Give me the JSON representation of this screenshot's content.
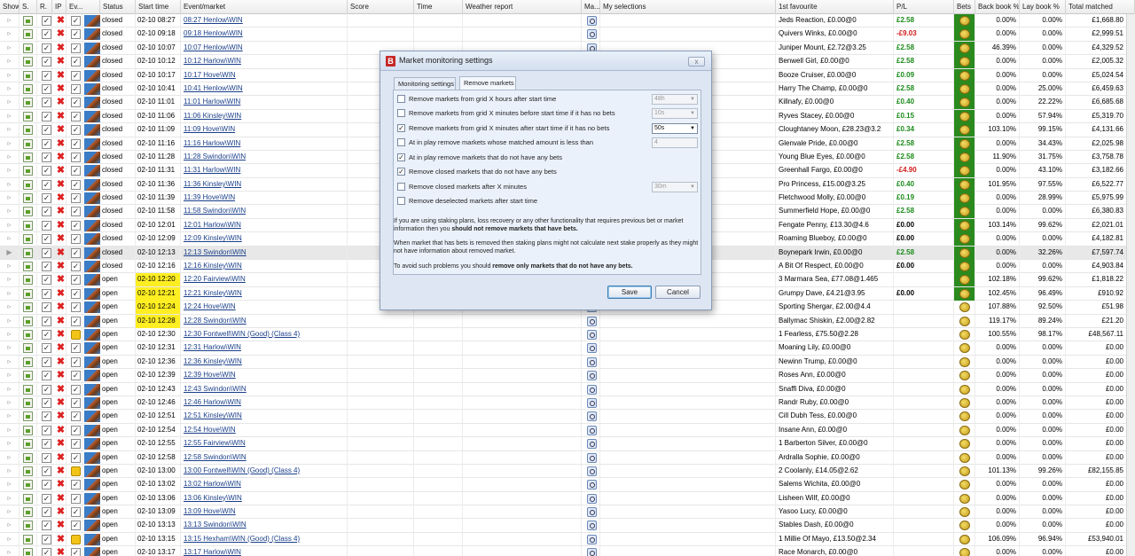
{
  "columns": {
    "show": "Show",
    "s": "S.",
    "r": "R.",
    "ip": "IP",
    "ev": "Ev...",
    "status": "Status",
    "start": "Start time",
    "event": "Event/market",
    "score": "Score",
    "time": "Time",
    "weather": "Weather report",
    "ma": "Ma...",
    "mysel": "My selections",
    "fav": "1st favourite",
    "pl": "P/L",
    "bets": "Bets",
    "back": "Back book %",
    "lay": "Lay book %",
    "total": "Total matched"
  },
  "rows": [
    {
      "status": "closed",
      "start": "02-10 08:27",
      "event": "08:27 Henlow\\WIN",
      "fav": "Jeds Reaction, £0.00@0",
      "pl": "£2.58",
      "back": "0.00%",
      "lay": "0.00%",
      "total": "£1,668.80"
    },
    {
      "status": "closed",
      "start": "02-10 09:18",
      "event": "09:18 Henlow\\WIN",
      "fav": "Quivers Winks, £0.00@0",
      "pl": "-£9.03",
      "back": "0.00%",
      "lay": "0.00%",
      "total": "£2,999.51"
    },
    {
      "status": "closed",
      "start": "02-10 10:07",
      "event": "10:07 Henlow\\WIN",
      "fav": "Juniper Mount, £2.72@3.25",
      "pl": "£2.58",
      "back": "46.39%",
      "lay": "0.00%",
      "total": "£4,329.52"
    },
    {
      "status": "closed",
      "start": "02-10 10:12",
      "event": "10:12 Harlow\\WIN",
      "fav": "Benwell Girl, £0.00@0",
      "pl": "£2.58",
      "back": "0.00%",
      "lay": "0.00%",
      "total": "£2,005.32"
    },
    {
      "status": "closed",
      "start": "02-10 10:17",
      "event": "10:17 Hove\\WIN",
      "fav": "Booze Cruiser, £0.00@0",
      "pl": "£0.09",
      "back": "0.00%",
      "lay": "0.00%",
      "total": "£5,024.54"
    },
    {
      "status": "closed",
      "start": "02-10 10:41",
      "event": "10:41 Henlow\\WIN",
      "fav": "Harry The Champ, £0.00@0",
      "pl": "£2.58",
      "back": "0.00%",
      "lay": "25.00%",
      "total": "£6,459.63"
    },
    {
      "status": "closed",
      "start": "02-10 11:01",
      "event": "11:01 Harlow\\WIN",
      "fav": "Killnafy, £0.00@0",
      "pl": "£0.40",
      "back": "0.00%",
      "lay": "22.22%",
      "total": "£6,685.68"
    },
    {
      "status": "closed",
      "start": "02-10 11:06",
      "event": "11:06 Kinsley\\WIN",
      "fav": "Ryves Stacey, £0.00@0",
      "pl": "£0.15",
      "back": "0.00%",
      "lay": "57.94%",
      "total": "£5,319.70"
    },
    {
      "status": "closed",
      "start": "02-10 11:09",
      "event": "11:09 Hove\\WIN",
      "fav": "Cloughtaney Moon, £28.23@3.2",
      "pl": "£0.34",
      "back": "103.10%",
      "lay": "99.15%",
      "total": "£4,131.66"
    },
    {
      "status": "closed",
      "start": "02-10 11:16",
      "event": "11:16 Harlow\\WIN",
      "fav": "Glenvale Pride, £0.00@0",
      "pl": "£2.58",
      "back": "0.00%",
      "lay": "34.43%",
      "total": "£2,025.98"
    },
    {
      "status": "closed",
      "start": "02-10 11:28",
      "event": "11:28 Swindon\\WIN",
      "fav": "Young Blue Eyes, £0.00@0",
      "pl": "£2.58",
      "back": "11.90%",
      "lay": "31.75%",
      "total": "£3,758.78"
    },
    {
      "status": "closed",
      "start": "02-10 11:31",
      "event": "11:31 Harlow\\WIN",
      "fav": "Greenhall Fargo, £0.00@0",
      "pl": "-£4.90",
      "back": "0.00%",
      "lay": "43.10%",
      "total": "£3,182.66"
    },
    {
      "status": "closed",
      "start": "02-10 11:36",
      "event": "11:36 Kinsley\\WIN",
      "fav": "Pro Princess, £15.00@3.25",
      "pl": "£0.40",
      "back": "101.95%",
      "lay": "97.55%",
      "total": "£6,522.77"
    },
    {
      "status": "closed",
      "start": "02-10 11:39",
      "event": "11:39 Hove\\WIN",
      "fav": "Fletchwood Molly, £0.00@0",
      "pl": "£0.19",
      "back": "0.00%",
      "lay": "28.99%",
      "total": "£5,975.99"
    },
    {
      "status": "closed",
      "start": "02-10 11:58",
      "event": "11:58 Swindon\\WIN",
      "fav": "Summerfield Hope, £0.00@0",
      "pl": "£2.58",
      "back": "0.00%",
      "lay": "0.00%",
      "total": "£6,380.83"
    },
    {
      "status": "closed",
      "start": "02-10 12:01",
      "event": "12:01 Harlow\\WIN",
      "fav": "Fengate Penny, £13.30@4.6",
      "pl": "£0.00",
      "back": "103.14%",
      "lay": "99.62%",
      "total": "£2,021.01"
    },
    {
      "status": "closed",
      "start": "02-10 12:09",
      "event": "12:09 Kinsley\\WIN",
      "fav": "Roaming Blueboy, £0.00@0",
      "pl": "£0.00",
      "back": "0.00%",
      "lay": "0.00%",
      "total": "£4,182.81"
    },
    {
      "status": "closed",
      "start": "02-10 12:13",
      "event": "12:13 Swindon\\WIN",
      "fav": "Boynepark Irwin, £0.00@0",
      "pl": "£2.58",
      "back": "0.00%",
      "lay": "32.26%",
      "total": "£7,597.74"
    },
    {
      "status": "closed",
      "start": "02-10 12:16",
      "event": "12:16 Kinsley\\WIN",
      "fav": "A Bit Of Respect, £0.00@0",
      "pl": "£0.00",
      "back": "0.00%",
      "lay": "0.00%",
      "total": "£4,903.84"
    },
    {
      "status": "open",
      "start": "02-10 12:20",
      "event": "12:20 Fairview\\WIN",
      "fav": "3 Marmara Sea, £77.08@1.465",
      "pl": "",
      "back": "102.18%",
      "lay": "99.62%",
      "total": "£1,818.22"
    },
    {
      "status": "open",
      "start": "02-10 12:21",
      "event": "12:21 Kinsley\\WIN",
      "fav": "Grumpy Dave, £4.21@3.95",
      "pl": "£0.00",
      "back": "102.45%",
      "lay": "96.49%",
      "total": "£910.92"
    },
    {
      "status": "open",
      "start": "02-10 12:24",
      "event": "12:24 Hove\\WIN",
      "fav": "Sporting Shergar, £2.00@4.4",
      "pl": "",
      "back": "107.88%",
      "lay": "92.50%",
      "total": "£51.98"
    },
    {
      "status": "open",
      "start": "02-10 12:28",
      "event": "12:28 Swindon\\WIN",
      "fav": "Ballymac Shiskin, £2.00@2.82",
      "pl": "",
      "back": "119.17%",
      "lay": "89.24%",
      "total": "£21.20"
    },
    {
      "status": "open",
      "start": "02-10 12:30",
      "event": "12:30 Fontwell\\WIN (Good) (Class 4)",
      "fav": "1 Fearless, £75.50@2.28",
      "pl": "",
      "back": "100.55%",
      "lay": "98.17%",
      "total": "£48,567.11"
    },
    {
      "status": "open",
      "start": "02-10 12:31",
      "event": "12:31 Harlow\\WIN",
      "fav": "Moaning Lily, £0.00@0",
      "pl": "",
      "back": "0.00%",
      "lay": "0.00%",
      "total": "£0.00"
    },
    {
      "status": "open",
      "start": "02-10 12:36",
      "event": "12:36 Kinsley\\WIN",
      "fav": "Newinn Trump, £0.00@0",
      "pl": "",
      "back": "0.00%",
      "lay": "0.00%",
      "total": "£0.00"
    },
    {
      "status": "open",
      "start": "02-10 12:39",
      "event": "12:39 Hove\\WIN",
      "fav": "Roses Ann, £0.00@0",
      "pl": "",
      "back": "0.00%",
      "lay": "0.00%",
      "total": "£0.00"
    },
    {
      "status": "open",
      "start": "02-10 12:43",
      "event": "12:43 Swindon\\WIN",
      "fav": "Snaffi Diva, £0.00@0",
      "pl": "",
      "back": "0.00%",
      "lay": "0.00%",
      "total": "£0.00"
    },
    {
      "status": "open",
      "start": "02-10 12:46",
      "event": "12:46 Harlow\\WIN",
      "fav": "Randr Ruby, £0.00@0",
      "pl": "",
      "back": "0.00%",
      "lay": "0.00%",
      "total": "£0.00"
    },
    {
      "status": "open",
      "start": "02-10 12:51",
      "event": "12:51 Kinsley\\WIN",
      "fav": "Cill Dubh Tess, £0.00@0",
      "pl": "",
      "back": "0.00%",
      "lay": "0.00%",
      "total": "£0.00"
    },
    {
      "status": "open",
      "start": "02-10 12:54",
      "event": "12:54 Hove\\WIN",
      "fav": "Insane Ann, £0.00@0",
      "pl": "",
      "back": "0.00%",
      "lay": "0.00%",
      "total": "£0.00"
    },
    {
      "status": "open",
      "start": "02-10 12:55",
      "event": "12:55 Fairview\\WIN",
      "fav": "1 Barberton Silver, £0.00@0",
      "pl": "",
      "back": "0.00%",
      "lay": "0.00%",
      "total": "£0.00"
    },
    {
      "status": "open",
      "start": "02-10 12:58",
      "event": "12:58 Swindon\\WIN",
      "fav": "Ardralla Sophie, £0.00@0",
      "pl": "",
      "back": "0.00%",
      "lay": "0.00%",
      "total": "£0.00"
    },
    {
      "status": "open",
      "start": "02-10 13:00",
      "event": "13:00 Fontwell\\WIN (Good) (Class 4)",
      "fav": "2 Coolanly, £14.05@2.62",
      "pl": "",
      "back": "101.13%",
      "lay": "99.26%",
      "total": "£82,155.85"
    },
    {
      "status": "open",
      "start": "02-10 13:02",
      "event": "13:02 Harlow\\WIN",
      "fav": "Salems Wichita, £0.00@0",
      "pl": "",
      "back": "0.00%",
      "lay": "0.00%",
      "total": "£0.00"
    },
    {
      "status": "open",
      "start": "02-10 13:06",
      "event": "13:06 Kinsley\\WIN",
      "fav": "Lisheen Wilf, £0.00@0",
      "pl": "",
      "back": "0.00%",
      "lay": "0.00%",
      "total": "£0.00"
    },
    {
      "status": "open",
      "start": "02-10 13:09",
      "event": "13:09 Hove\\WIN",
      "fav": "Yasoo Lucy, £0.00@0",
      "pl": "",
      "back": "0.00%",
      "lay": "0.00%",
      "total": "£0.00"
    },
    {
      "status": "open",
      "start": "02-10 13:13",
      "event": "13:13 Swindon\\WIN",
      "fav": "Stables Dash, £0.00@0",
      "pl": "",
      "back": "0.00%",
      "lay": "0.00%",
      "total": "£0.00"
    },
    {
      "status": "open",
      "start": "02-10 13:15",
      "event": "13:15 Hexham\\WIN (Good) (Class 4)",
      "fav": "1 Millie Of Mayo, £13.50@2.34",
      "pl": "",
      "back": "106.09%",
      "lay": "96.94%",
      "total": "£53,940.01"
    },
    {
      "status": "open",
      "start": "02-10 13:17",
      "event": "13:17 Harlow\\WIN",
      "fav": "Race Monarch, £0.00@0",
      "pl": "",
      "back": "0.00%",
      "lay": "0.00%",
      "total": "£0.00"
    }
  ],
  "dialog": {
    "title": "Market monitoring settings",
    "close_label": "x",
    "tabs": [
      "Monitoring settings",
      "Remove markets"
    ],
    "options": [
      {
        "label": "Remove markets from grid X hours after start time",
        "checked": false,
        "control": "select",
        "value": "48h"
      },
      {
        "label": "Remove markets from grid X minutes before start time if it has no bets",
        "checked": false,
        "control": "select",
        "value": "10s"
      },
      {
        "label": "Remove markets from grid X minutes after start time if it has no bets",
        "checked": true,
        "control": "select",
        "value": "50s"
      },
      {
        "label": "At in play remove markets whose matched amount is less than",
        "checked": false,
        "control": "number",
        "value": "4"
      },
      {
        "label": "At in play remove markets that do not have any bets",
        "checked": true,
        "control": "",
        "value": ""
      },
      {
        "label": "Remove closed markets that do not have any bets",
        "checked": true,
        "control": "",
        "value": ""
      },
      {
        "label": "Remove closed markets after X minutes",
        "checked": false,
        "control": "select",
        "value": "30m"
      },
      {
        "label": "Remove deselected markets after start time",
        "checked": false,
        "control": "",
        "value": ""
      }
    ],
    "note1_pre": "If you are using staking plans, loss recovery or any other functionality that requires previous bet or market information then you ",
    "note1_bold": "should not remove markets that have bets.",
    "note2": "When market that has bets is removed then staking plans might not calculate next stake properly as they might not have information about removed market.",
    "note3_pre": "To avoid such problems you should ",
    "note3_bold": "remove only markets that do not have any bets.",
    "save_label": "Save",
    "cancel_label": "Cancel"
  },
  "colors": {
    "positive": "#1a8a1a",
    "negative": "#d01818",
    "highlight": "#ffee22",
    "bets_green": "#2a8a1e"
  },
  "icons": {
    "s": "spreadsheet-icon",
    "r": "checkbox-icon",
    "x": "delete-icon",
    "ip": "checkbox-icon",
    "ev": "event-thumbnail-icon",
    "ma": "search-icon",
    "bets": "coin-icon",
    "logo": "betfair-logo-icon"
  }
}
